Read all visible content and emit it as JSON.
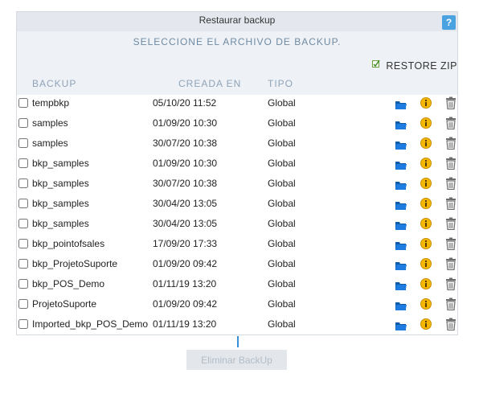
{
  "dialog": {
    "title": "Restaurar backup",
    "help_label": "?",
    "subtitle": "SELECCIONE EL ARCHIVO DE BACKUP.",
    "restore_zip_label": "RESTORE ZIP"
  },
  "columns": {
    "backup": "BACKUP",
    "created": "CREADA EN",
    "type": "TIPO"
  },
  "rows": [
    {
      "name": "tempbkp",
      "date": "05/10/20 11:52",
      "type": "Global"
    },
    {
      "name": "samples",
      "date": "01/09/20 10:30",
      "type": "Global"
    },
    {
      "name": "samples",
      "date": "30/07/20 10:38",
      "type": "Global"
    },
    {
      "name": "bkp_samples",
      "date": "01/09/20 10:30",
      "type": "Global"
    },
    {
      "name": "bkp_samples",
      "date": "30/07/20 10:38",
      "type": "Global"
    },
    {
      "name": "bkp_samples",
      "date": "30/04/20 13:05",
      "type": "Global"
    },
    {
      "name": "bkp_samples",
      "date": "30/04/20 13:05",
      "type": "Global"
    },
    {
      "name": "bkp_pointofsales",
      "date": "17/09/20 17:33",
      "type": "Global"
    },
    {
      "name": "bkp_ProjetoSuporte",
      "date": "01/09/20 09:42",
      "type": "Global"
    },
    {
      "name": "bkp_POS_Demo",
      "date": "01/11/19 13:20",
      "type": "Global"
    },
    {
      "name": "ProjetoSuporte",
      "date": "01/09/20 09:42",
      "type": "Global"
    },
    {
      "name": "Imported_bkp_POS_Demo",
      "date": "01/11/19 13:20",
      "type": "Global"
    }
  ],
  "row_icons": [
    "folder-icon",
    "info-icon",
    "trash-icon"
  ],
  "footer": {
    "delete_label": "Eliminar BackUp"
  },
  "colors": {
    "folder": "#1565c0",
    "info": "#f2b705",
    "trash": "#707070",
    "help": "#4aa3e0",
    "accent_text": "#6f8aa3"
  }
}
